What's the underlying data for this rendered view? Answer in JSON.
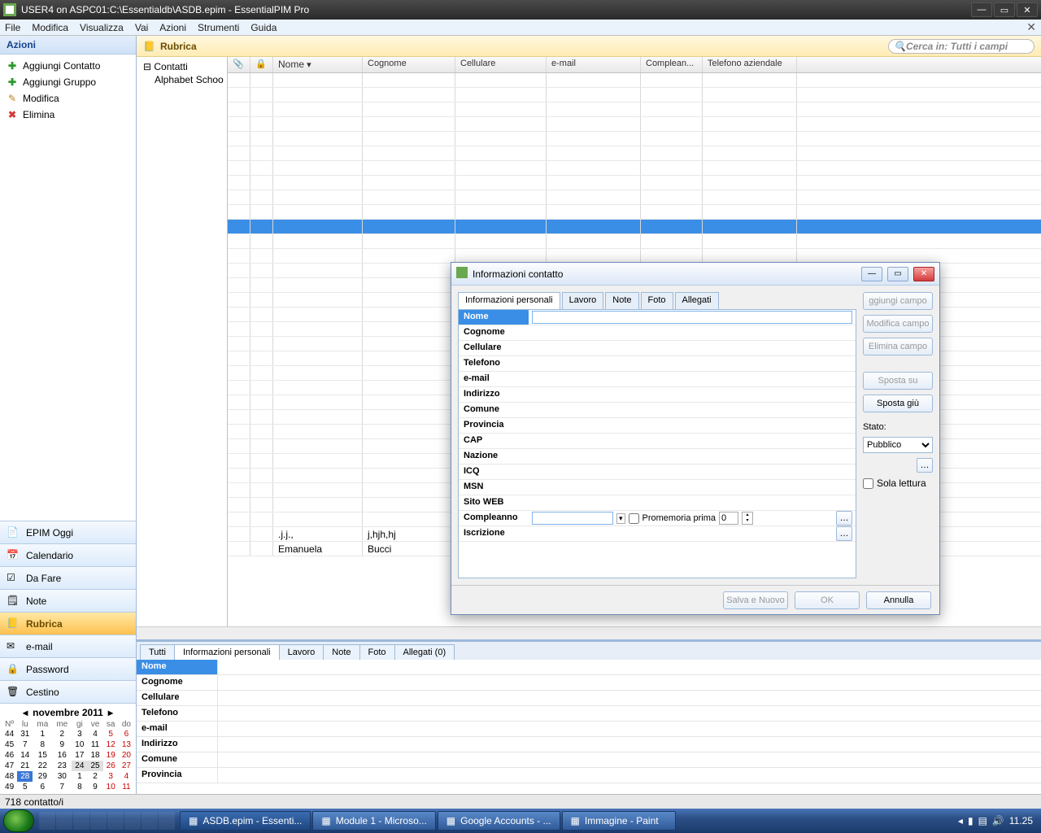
{
  "titlebar": {
    "text": "USER4 on ASPC01:C:\\Essentialdb\\ASDB.epim - EssentialPIM Pro"
  },
  "menubar": {
    "items": [
      "File",
      "Modifica",
      "Visualizza",
      "Vai",
      "Azioni",
      "Strumenti",
      "Guida"
    ]
  },
  "sidebar": {
    "header": "Azioni",
    "actions": [
      {
        "label": "Aggiungi Contatto"
      },
      {
        "label": "Aggiungi Gruppo"
      },
      {
        "label": "Modifica"
      },
      {
        "label": "Elimina"
      }
    ],
    "nav": [
      {
        "label": "EPIM Oggi"
      },
      {
        "label": "Calendario"
      },
      {
        "label": "Da Fare"
      },
      {
        "label": "Note"
      },
      {
        "label": "Rubrica"
      },
      {
        "label": "e-mail"
      },
      {
        "label": "Password"
      },
      {
        "label": "Cestino"
      }
    ],
    "calendar": {
      "month": "novembre  2011",
      "dow": [
        "Nº",
        "lu",
        "ma",
        "me",
        "gi",
        "ve",
        "sa",
        "do"
      ],
      "weeks": [
        [
          "44",
          "31",
          "1",
          "2",
          "3",
          "4",
          "5",
          "6"
        ],
        [
          "45",
          "7",
          "8",
          "9",
          "10",
          "11",
          "12",
          "13"
        ],
        [
          "46",
          "14",
          "15",
          "16",
          "17",
          "18",
          "19",
          "20"
        ],
        [
          "47",
          "21",
          "22",
          "23",
          "24",
          "25",
          "26",
          "27"
        ],
        [
          "48",
          "28",
          "29",
          "30",
          "1",
          "2",
          "3",
          "4"
        ],
        [
          "49",
          "5",
          "6",
          "7",
          "8",
          "9",
          "10",
          "11"
        ]
      ],
      "today_cell": "28",
      "hilite": [
        "24",
        "25"
      ]
    }
  },
  "rubrica": {
    "title": "Rubrica",
    "search_placeholder": "Cerca in: Tutti i campi"
  },
  "tree": {
    "root": "Contatti",
    "child": "Alphabet Schoo"
  },
  "grid": {
    "columns": [
      "",
      "",
      "Nome",
      "Cognome",
      "Cellulare",
      "e-mail",
      "Complean...",
      "Telefono aziendale"
    ],
    "rows_bottom": [
      {
        "nome": ".j.j.,",
        "cognome": "j,hjh,hj"
      },
      {
        "nome": "Emanuela",
        "cognome": "Bucci"
      }
    ]
  },
  "detail": {
    "tabs": [
      "Tutti",
      "Informazioni personali",
      "Lavoro",
      "Note",
      "Foto",
      "Allegati (0)"
    ],
    "active_tab": 1,
    "fields": [
      "Nome",
      "Cognome",
      "Cellulare",
      "Telefono",
      "e-mail",
      "Indirizzo",
      "Comune",
      "Provincia"
    ]
  },
  "dialog": {
    "title": "Informazioni contatto",
    "tabs": [
      "Informazioni personali",
      "Lavoro",
      "Note",
      "Foto",
      "Allegati"
    ],
    "fields": [
      "Nome",
      "Cognome",
      "Cellulare",
      "Telefono",
      "e-mail",
      "Indirizzo",
      "Comune",
      "Provincia",
      "CAP",
      "Nazione",
      "ICQ",
      "MSN",
      "Sito WEB",
      "Compleanno",
      "Iscrizione"
    ],
    "reminder_label": "Promemoria prima",
    "reminder_value": "0",
    "side_buttons": {
      "add": "ggiungi campo",
      "edit": "Modifica campo",
      "del": "Elimina campo",
      "up": "Sposta su",
      "down": "Sposta giù"
    },
    "state_label": "Stato:",
    "state_value": "Pubblico",
    "readonly_label": "Sola lettura",
    "footer": {
      "save_new": "Salva e Nuovo",
      "ok": "OK",
      "cancel": "Annulla"
    }
  },
  "statusbar": {
    "text": "718 contatto/i"
  },
  "taskbar": {
    "tasks": [
      "ASDB.epim - Essenti...",
      "Module 1 - Microso...",
      "Google Accounts - ...",
      "Immagine - Paint"
    ],
    "clock": "11.25"
  }
}
